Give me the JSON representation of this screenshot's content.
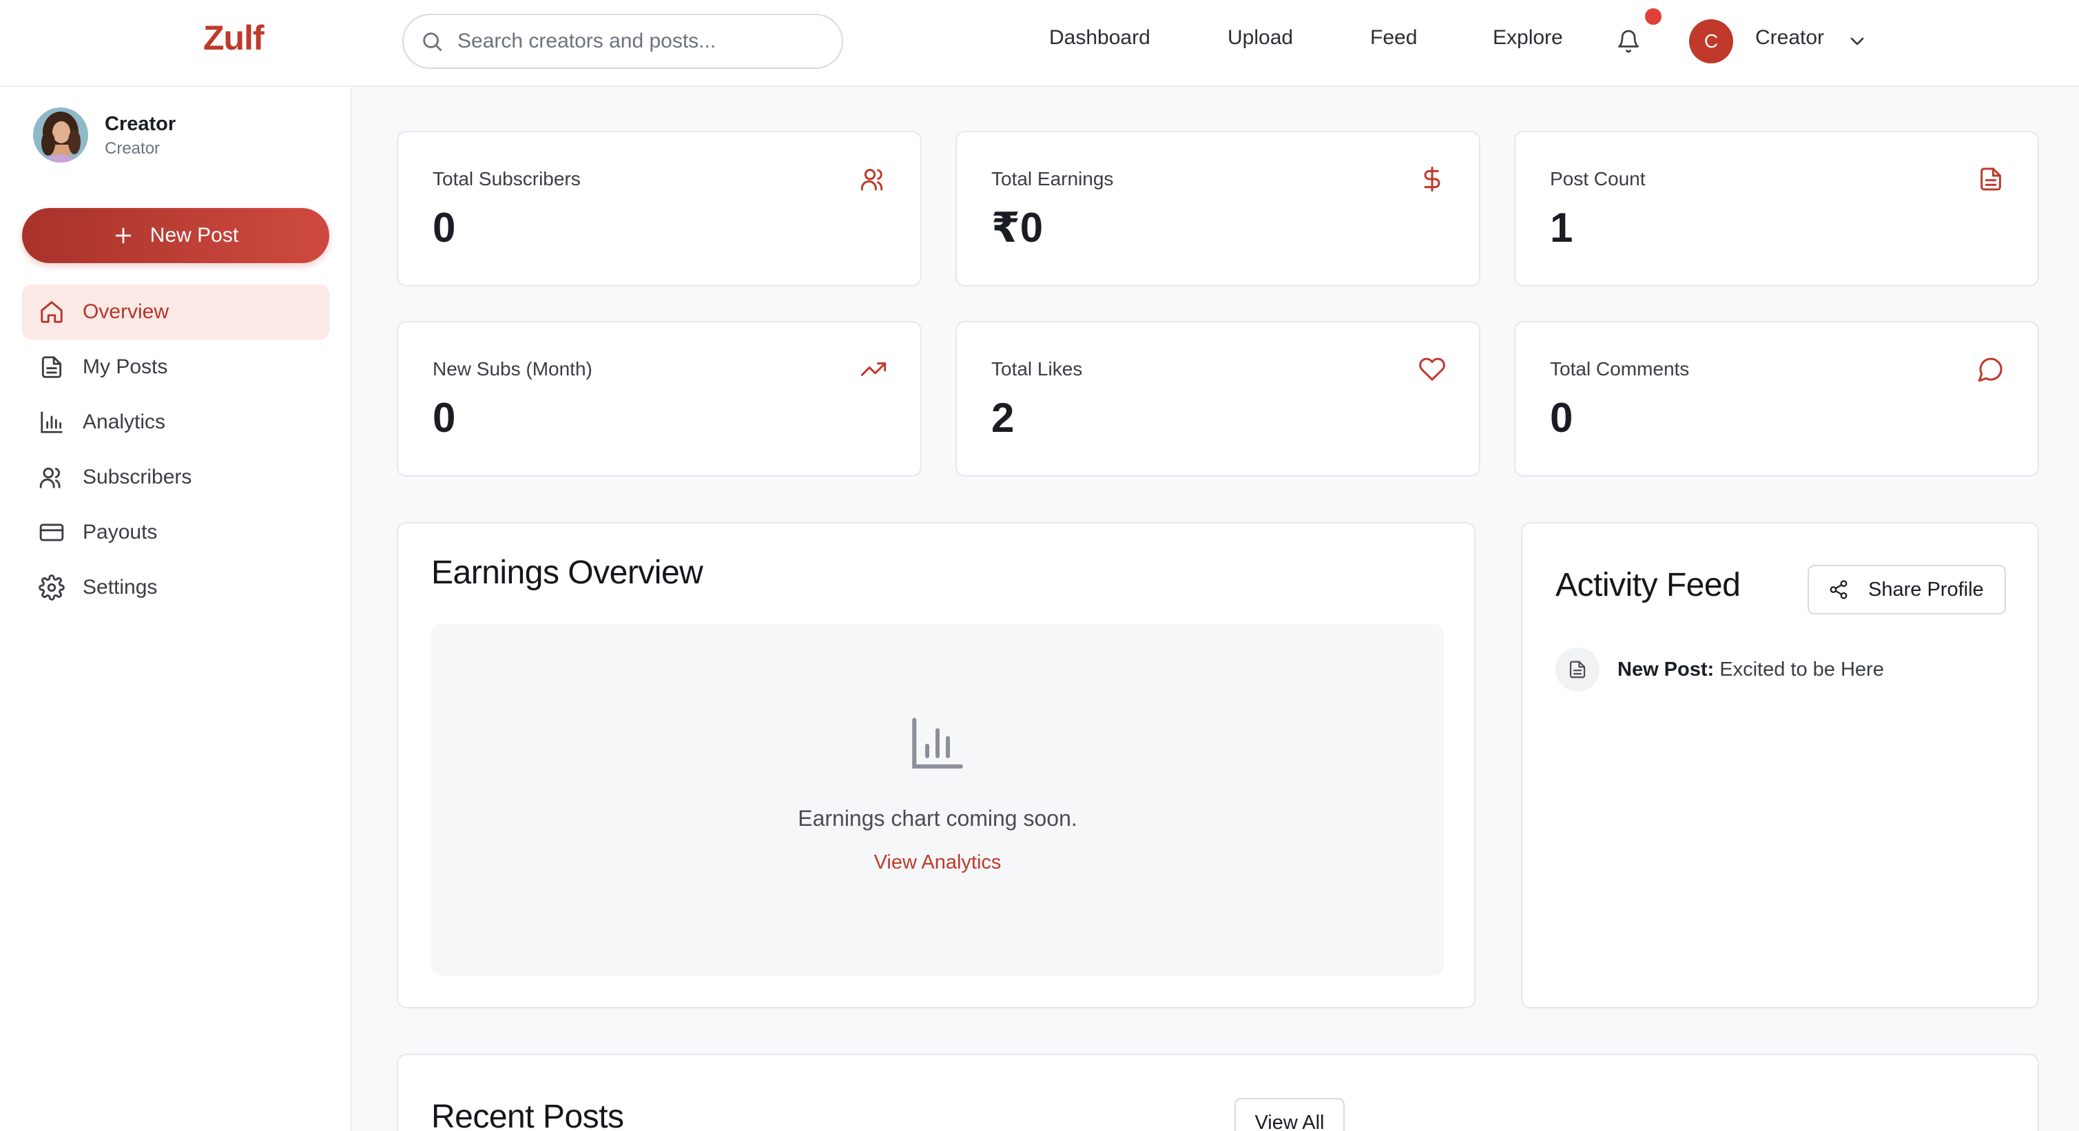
{
  "brand": {
    "logo": "Zulf",
    "accent_color": "#c0392b"
  },
  "search": {
    "placeholder": "Search creators and posts..."
  },
  "nav": {
    "links": [
      "Dashboard",
      "Upload",
      "Feed",
      "Explore"
    ],
    "notification_dot_color": "#e0403a"
  },
  "user": {
    "initial": "C",
    "name": "Creator"
  },
  "sidebar": {
    "profile_name": "Creator",
    "profile_role": "Creator",
    "new_post_label": "New Post",
    "items": [
      {
        "label": "Overview",
        "icon": "home-icon",
        "active": true
      },
      {
        "label": "My Posts",
        "icon": "file-icon",
        "active": false
      },
      {
        "label": "Analytics",
        "icon": "bar-chart-icon",
        "active": false
      },
      {
        "label": "Subscribers",
        "icon": "users-icon",
        "active": false
      },
      {
        "label": "Payouts",
        "icon": "credit-card-icon",
        "active": false
      },
      {
        "label": "Settings",
        "icon": "gear-icon",
        "active": false
      }
    ]
  },
  "stats": [
    {
      "label": "Total Subscribers",
      "value": "0",
      "icon": "users-icon"
    },
    {
      "label": "Total Earnings",
      "value": "₹0",
      "icon": "dollar-icon"
    },
    {
      "label": "Post Count",
      "value": "1",
      "icon": "file-icon"
    },
    {
      "label": "New Subs (Month)",
      "value": "0",
      "icon": "trending-up-icon"
    },
    {
      "label": "Total Likes",
      "value": "2",
      "icon": "heart-icon"
    },
    {
      "label": "Total Comments",
      "value": "0",
      "icon": "message-icon"
    }
  ],
  "earnings": {
    "title": "Earnings Overview",
    "message": "Earnings chart coming soon.",
    "link": "View Analytics"
  },
  "activity": {
    "title": "Activity Feed",
    "share_label": "Share Profile",
    "items": [
      {
        "type": "New Post:",
        "text": "Excited to be Here",
        "icon": "file-icon"
      }
    ]
  },
  "recent": {
    "title": "Recent Posts",
    "view_all": "View All"
  }
}
